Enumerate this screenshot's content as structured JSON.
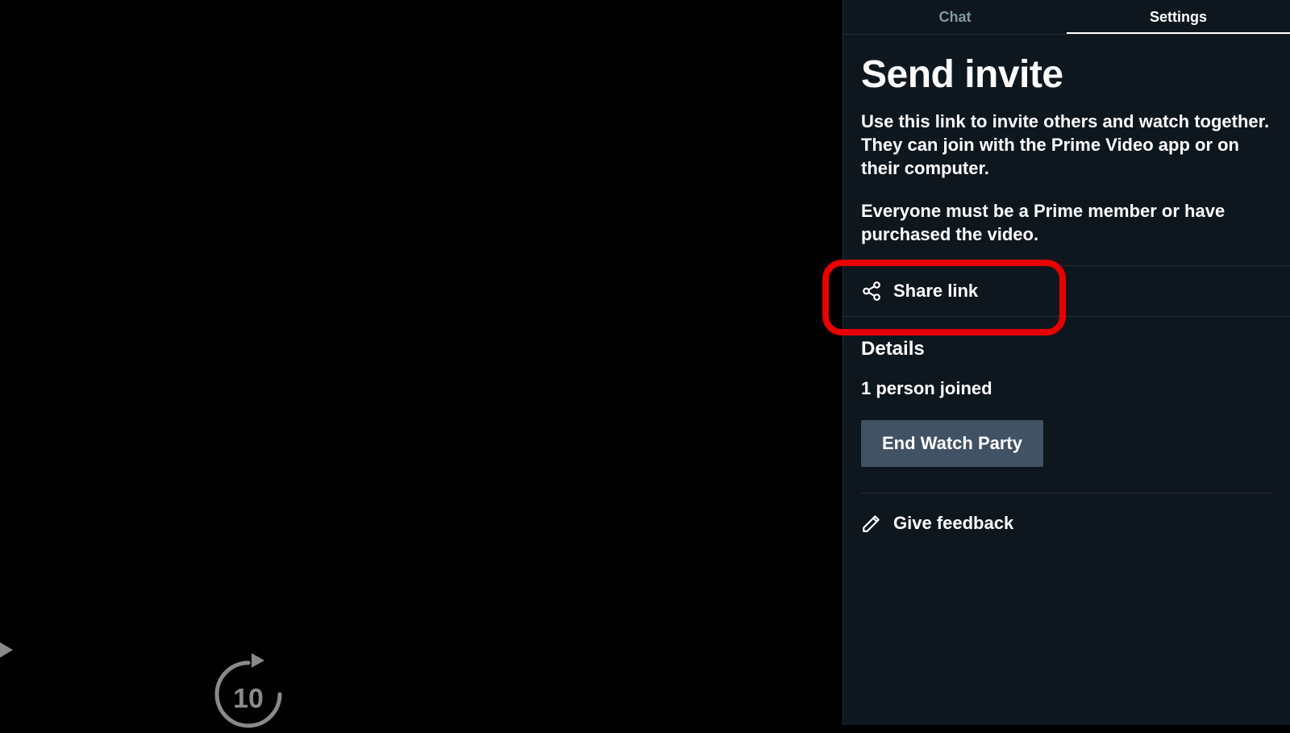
{
  "tabs": {
    "chat": "Chat",
    "settings": "Settings"
  },
  "invite": {
    "title": "Send invite",
    "p1": "Use this link to invite others and watch together. They can join with the Prime Video app or on their computer.",
    "p2": "Everyone must be a Prime member or have purchased the video.",
    "share_label": "Share link"
  },
  "details": {
    "heading": "Details",
    "joined": "1 person joined",
    "end_label": "End Watch Party"
  },
  "feedback": {
    "label": "Give feedback"
  },
  "player": {
    "skip_amount": "10"
  }
}
